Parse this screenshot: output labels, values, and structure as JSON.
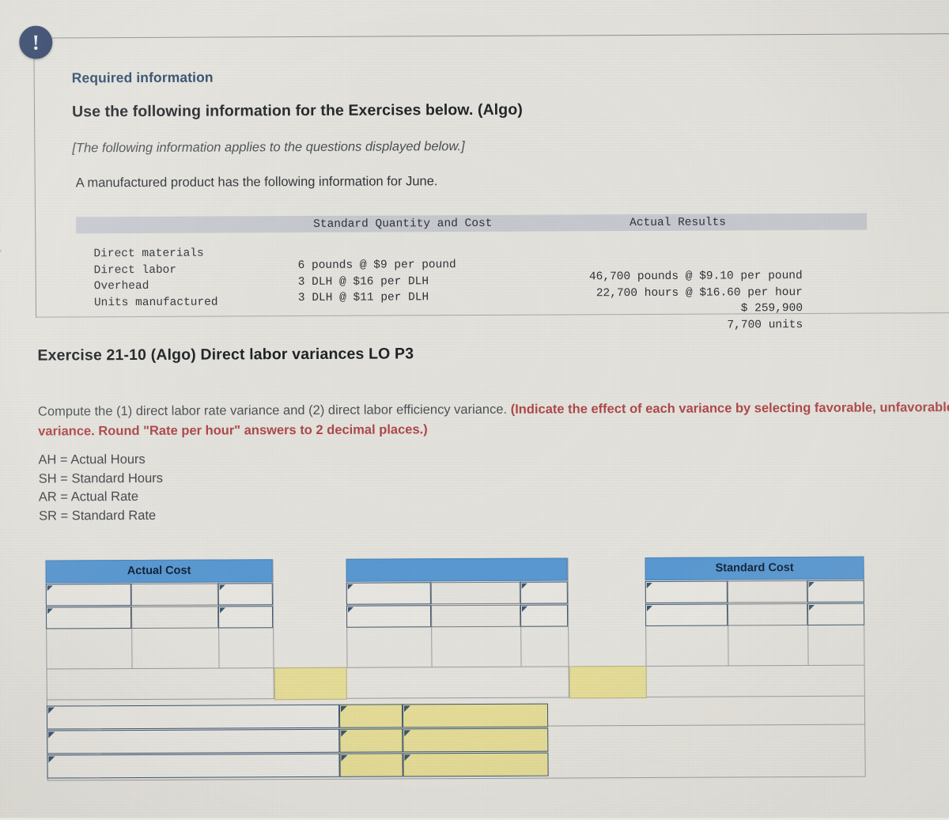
{
  "callout": {
    "icon": "exclamation-circle-icon",
    "required_label": "Required information",
    "heading": "Use the following information for the Exercises below. (Algo)",
    "applies_note": "[The following information applies to the questions displayed below.]",
    "intro": "A manufactured product has the following information for June."
  },
  "data_table": {
    "col_headers": {
      "blank": "",
      "standard": "Standard Quantity and Cost",
      "actual": "Actual Results"
    },
    "rows": [
      {
        "label": "Direct materials",
        "standard": "6 pounds @ $9 per pound",
        "actual": "46,700 pounds @ $9.10 per pound"
      },
      {
        "label": "Direct labor",
        "standard": "3 DLH @ $16 per DLH",
        "actual": "22,700 hours @ $16.60 per hour"
      },
      {
        "label": "Overhead",
        "standard": "3 DLH @ $11 per DLH",
        "actual": "$ 259,900"
      },
      {
        "label": "Units manufactured",
        "standard": "",
        "actual": "7,700 units"
      }
    ]
  },
  "exercise": {
    "title": "Exercise 21-10 (Algo) Direct labor variances LO P3",
    "prompt_plain": "Compute the (1) direct labor rate variance and (2) direct labor efficiency variance. ",
    "prompt_bold": "(Indicate the effect of each variance by selecting favorable, unfavorable, or no variance. Round \"Rate per hour\" answers to 2 decimal places.)"
  },
  "legend": {
    "lines": [
      "AH = Actual Hours",
      "SH = Standard Hours",
      "AR = Actual Rate",
      "SR = Standard Rate"
    ]
  },
  "answer_grid": {
    "headers": {
      "actual_cost": "Actual Cost",
      "middle": "",
      "standard_cost": "Standard Cost"
    },
    "cell_value": "",
    "colors": {
      "header_blue": "#5b9bd5",
      "input_border": "#3e5873",
      "highlight_yellow": "#e9e09a",
      "badge_navy": "#2c3f68",
      "accent_red": "#b0494a",
      "req_blue": "#2a4a6b"
    }
  }
}
